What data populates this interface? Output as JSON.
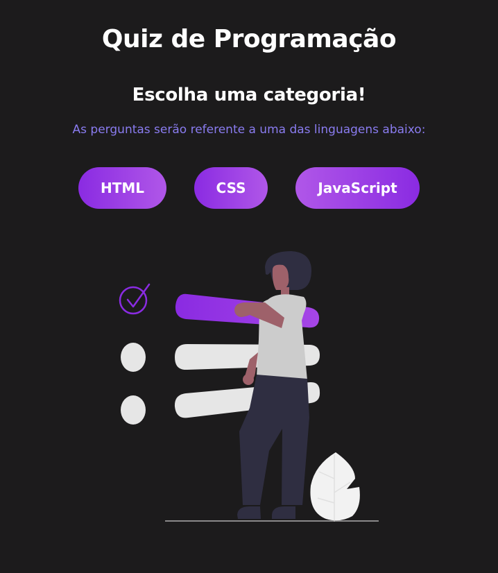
{
  "header": {
    "title": "Quiz de Programação",
    "subtitle": "Escolha uma categoria!",
    "description": "As perguntas serão referente a uma das linguagens abaixo:"
  },
  "categories": [
    {
      "label": "HTML"
    },
    {
      "label": "CSS"
    },
    {
      "label": "JavaScript"
    }
  ],
  "colors": {
    "background": "#1c1b1c",
    "accent": "#8a2be2",
    "accent_light": "#b057e8",
    "description_text": "#8a7cf0"
  },
  "illustration": {
    "icon": "quiz-checklist-person-illustration"
  }
}
